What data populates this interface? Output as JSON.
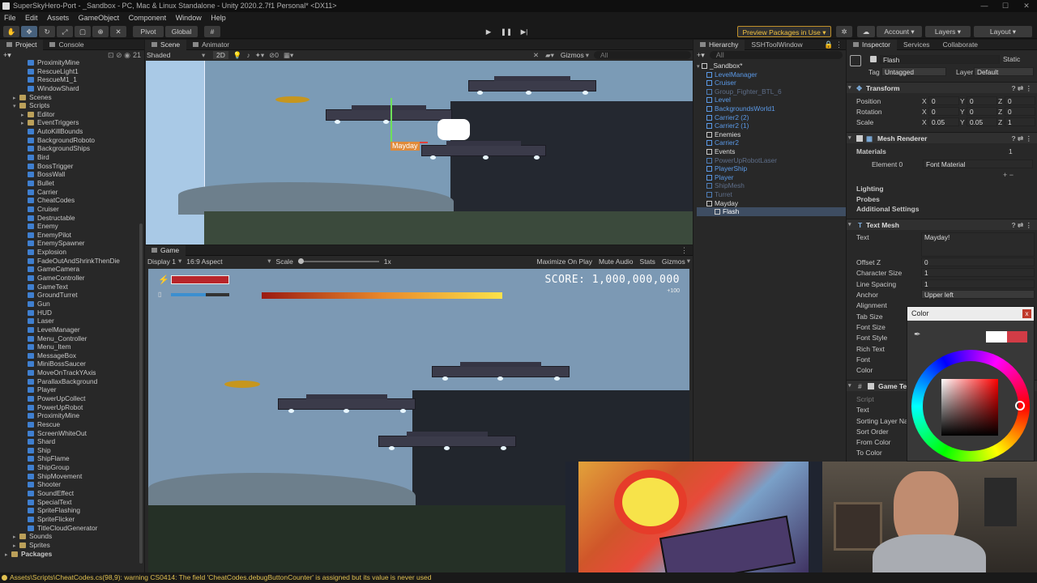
{
  "title": "SuperSkyHero-Port - _Sandbox - PC, Mac & Linux Standalone - Unity 2020.2.7f1 Personal* <DX11>",
  "menu": [
    "File",
    "Edit",
    "Assets",
    "GameObject",
    "Component",
    "Window",
    "Help"
  ],
  "toolbar": {
    "pivot": "Pivot",
    "global": "Global",
    "preview": "Preview Packages in Use",
    "account": "Account",
    "layers": "Layers",
    "layout": "Layout"
  },
  "project": {
    "tabs": [
      "Project",
      "Console"
    ],
    "count": "21",
    "items": [
      {
        "label": "ProximityMine",
        "kind": "cs",
        "indent": 2
      },
      {
        "label": "RescueLight1",
        "kind": "cs",
        "indent": 2
      },
      {
        "label": "RescueM1_1",
        "kind": "cs",
        "indent": 2
      },
      {
        "label": "WindowShard",
        "kind": "cs",
        "indent": 2
      },
      {
        "label": "Scenes",
        "kind": "fo",
        "indent": 1,
        "arrow": "▸"
      },
      {
        "label": "Scripts",
        "kind": "fo",
        "indent": 1,
        "arrow": "▾"
      },
      {
        "label": "Editor",
        "kind": "fo",
        "indent": 2,
        "arrow": "▸"
      },
      {
        "label": "EventTriggers",
        "kind": "fo",
        "indent": 2,
        "arrow": "▸"
      },
      {
        "label": "AutoKillBounds",
        "kind": "cs",
        "indent": 2
      },
      {
        "label": "BackgroundRoboto",
        "kind": "cs",
        "indent": 2
      },
      {
        "label": "BackgroundShips",
        "kind": "cs",
        "indent": 2
      },
      {
        "label": "Bird",
        "kind": "cs",
        "indent": 2
      },
      {
        "label": "BossTrigger",
        "kind": "cs",
        "indent": 2
      },
      {
        "label": "BossWall",
        "kind": "cs",
        "indent": 2
      },
      {
        "label": "Bullet",
        "kind": "cs",
        "indent": 2
      },
      {
        "label": "Carrier",
        "kind": "cs",
        "indent": 2
      },
      {
        "label": "CheatCodes",
        "kind": "cs",
        "indent": 2
      },
      {
        "label": "Cruiser",
        "kind": "cs",
        "indent": 2
      },
      {
        "label": "Destructable",
        "kind": "cs",
        "indent": 2
      },
      {
        "label": "Enemy",
        "kind": "cs",
        "indent": 2
      },
      {
        "label": "EnemyPilot",
        "kind": "cs",
        "indent": 2
      },
      {
        "label": "EnemySpawner",
        "kind": "cs",
        "indent": 2
      },
      {
        "label": "Explosion",
        "kind": "cs",
        "indent": 2
      },
      {
        "label": "FadeOutAndShrinkThenDie",
        "kind": "cs",
        "indent": 2
      },
      {
        "label": "GameCamera",
        "kind": "cs",
        "indent": 2
      },
      {
        "label": "GameController",
        "kind": "cs",
        "indent": 2
      },
      {
        "label": "GameText",
        "kind": "cs",
        "indent": 2
      },
      {
        "label": "GroundTurret",
        "kind": "cs",
        "indent": 2
      },
      {
        "label": "Gun",
        "kind": "cs",
        "indent": 2
      },
      {
        "label": "HUD",
        "kind": "cs",
        "indent": 2
      },
      {
        "label": "Laser",
        "kind": "cs",
        "indent": 2
      },
      {
        "label": "LevelManager",
        "kind": "cs",
        "indent": 2
      },
      {
        "label": "Menu_Controller",
        "kind": "cs",
        "indent": 2
      },
      {
        "label": "Menu_Item",
        "kind": "cs",
        "indent": 2
      },
      {
        "label": "MessageBox",
        "kind": "cs",
        "indent": 2
      },
      {
        "label": "MiniBossSaucer",
        "kind": "cs",
        "indent": 2
      },
      {
        "label": "MoveOnTrackYAxis",
        "kind": "cs",
        "indent": 2
      },
      {
        "label": "ParallaxBackground",
        "kind": "cs",
        "indent": 2
      },
      {
        "label": "Player",
        "kind": "cs",
        "indent": 2
      },
      {
        "label": "PowerUpCollect",
        "kind": "cs",
        "indent": 2
      },
      {
        "label": "PowerUpRobot",
        "kind": "cs",
        "indent": 2
      },
      {
        "label": "ProximityMine",
        "kind": "cs",
        "indent": 2
      },
      {
        "label": "Rescue",
        "kind": "cs",
        "indent": 2
      },
      {
        "label": "ScreenWhiteOut",
        "kind": "cs",
        "indent": 2
      },
      {
        "label": "Shard",
        "kind": "cs",
        "indent": 2
      },
      {
        "label": "Ship",
        "kind": "cs",
        "indent": 2
      },
      {
        "label": "ShipFlame",
        "kind": "cs",
        "indent": 2
      },
      {
        "label": "ShipGroup",
        "kind": "cs",
        "indent": 2
      },
      {
        "label": "ShipMovement",
        "kind": "cs",
        "indent": 2
      },
      {
        "label": "Shooter",
        "kind": "cs",
        "indent": 2
      },
      {
        "label": "SoundEffect",
        "kind": "cs",
        "indent": 2
      },
      {
        "label": "SpecialText",
        "kind": "cs",
        "indent": 2
      },
      {
        "label": "SpriteFlashing",
        "kind": "cs",
        "indent": 2
      },
      {
        "label": "SpriteFlicker",
        "kind": "cs",
        "indent": 2
      },
      {
        "label": "TitleCloudGenerator",
        "kind": "cs",
        "indent": 2
      },
      {
        "label": "Sounds",
        "kind": "fo",
        "indent": 1,
        "arrow": "▸"
      },
      {
        "label": "Sprites",
        "kind": "fo",
        "indent": 1,
        "arrow": "▸"
      },
      {
        "label": "Packages",
        "kind": "fo",
        "indent": 0,
        "arrow": "▸",
        "bold": true
      }
    ]
  },
  "scene": {
    "tabs": [
      "Scene",
      "Animator"
    ],
    "shading": "Shaded",
    "mode2d": "2D",
    "gizmos": "Gizmos",
    "search": "All",
    "label": "Mayday"
  },
  "game": {
    "tab": "Game",
    "display": "Display 1",
    "aspect": "16:9 Aspect",
    "scale_label": "Scale",
    "scale_value": "1x",
    "maximize": "Maximize On Play",
    "mute": "Mute Audio",
    "stats": "Stats",
    "gizmos": "Gizmos",
    "score": "SCORE: 1,000,000,000",
    "bonus": "+100",
    "health_fraction": 1,
    "boost_fraction": 0.6
  },
  "hierarchy": {
    "tabs": [
      "Hierarchy",
      "SSHToolWindow"
    ],
    "search": "All",
    "root": "_Sandbox*",
    "items": [
      {
        "label": "LevelManager",
        "style": "b",
        "indent": 1
      },
      {
        "label": "Cruiser",
        "style": "b",
        "indent": 1
      },
      {
        "label": "Group_Fighter_BTL_6",
        "style": "g",
        "indent": 1
      },
      {
        "label": "Level",
        "style": "b",
        "indent": 1
      },
      {
        "label": "BackgroundsWorld1",
        "style": "b",
        "indent": 1
      },
      {
        "label": "Carrier2 (2)",
        "style": "b",
        "indent": 1
      },
      {
        "label": "Carrier2 (1)",
        "style": "b",
        "indent": 1
      },
      {
        "label": "Enemies",
        "style": "w",
        "indent": 1
      },
      {
        "label": "Carrier2",
        "style": "b",
        "indent": 1
      },
      {
        "label": "Events",
        "style": "w",
        "indent": 1
      },
      {
        "label": "PowerUpRobotLaser",
        "style": "g",
        "indent": 1
      },
      {
        "label": "PlayerShip",
        "style": "b",
        "indent": 1
      },
      {
        "label": "Player",
        "style": "b",
        "indent": 1
      },
      {
        "label": "ShipMesh",
        "style": "g",
        "indent": 1
      },
      {
        "label": "Turret",
        "style": "g",
        "indent": 1
      },
      {
        "label": "Mayday",
        "style": "w",
        "indent": 1
      },
      {
        "label": "Flash",
        "style": "w",
        "indent": 2,
        "selected": true
      }
    ]
  },
  "inspector": {
    "tabs": [
      "Inspector",
      "Services",
      "Collaborate"
    ],
    "name": "Flash",
    "static": "Static",
    "tag_label": "Tag",
    "tag": "Untagged",
    "layer_label": "Layer",
    "layer": "Default",
    "transform": {
      "title": "Transform",
      "position": {
        "label": "Position",
        "x": "0",
        "y": "0",
        "z": "0"
      },
      "rotation": {
        "label": "Rotation",
        "x": "0",
        "y": "0",
        "z": "0"
      },
      "scale": {
        "label": "Scale",
        "x": "0.05",
        "y": "0.05",
        "z": "1"
      }
    },
    "mesh_renderer": {
      "title": "Mesh Renderer",
      "materials": "Materials",
      "materials_count": "1",
      "element0": "Element 0",
      "element0_value": "Font Material",
      "lighting": "Lighting",
      "probes": "Probes",
      "additional": "Additional Settings"
    },
    "text_mesh": {
      "title": "Text Mesh",
      "text_label": "Text",
      "text_value": "Mayday!",
      "offset_z": "Offset Z",
      "offset_z_value": "0",
      "char_size": "Character Size",
      "char_size_value": "1",
      "line_spacing": "Line Spacing",
      "line_spacing_value": "1",
      "anchor": "Anchor",
      "anchor_value": "Upper left",
      "alignment": "Alignment",
      "tab_size": "Tab Size",
      "font_size": "Font Size",
      "font_style": "Font Style",
      "rich_text": "Rich Text",
      "font": "Font",
      "color": "Color"
    },
    "game_text": {
      "title": "Game Te",
      "script": "Script",
      "text": "Text",
      "sorting_layer": "Sorting Layer Na",
      "sort_order": "Sort Order",
      "from_color": "From Color",
      "to_color": "To Color"
    }
  },
  "color_picker": {
    "title": "Color",
    "close": "x",
    "current_color": "#ffffff",
    "previous_color": "#d23c46"
  },
  "status_bar": "Assets\\Scripts\\CheatCodes.cs(98,9): warning CS0414: The field 'CheatCodes.debugButtonCounter' is assigned but its value is never used"
}
